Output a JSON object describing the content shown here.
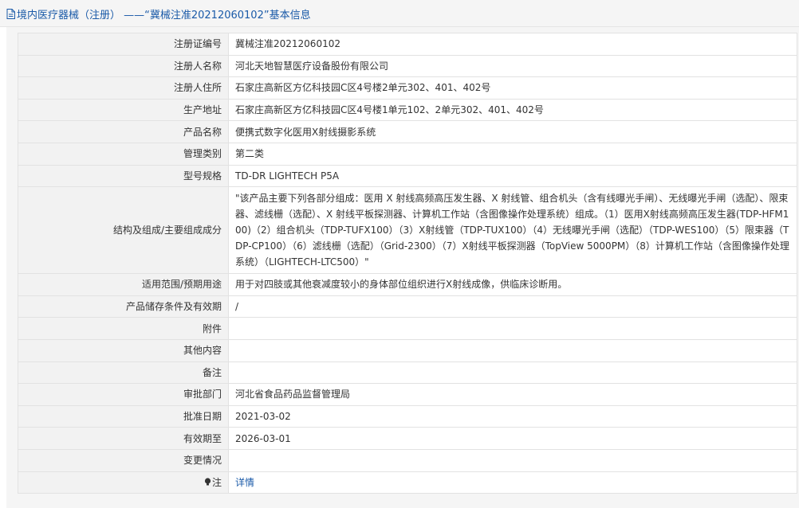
{
  "header": {
    "title": "境内医疗器械（注册） ——“冀械注准20212060102”基本信息"
  },
  "rows": [
    {
      "label": "注册证编号",
      "value": "冀械注准20212060102"
    },
    {
      "label": "注册人名称",
      "value": "河北天地智慧医疗设备股份有限公司"
    },
    {
      "label": "注册人住所",
      "value": "石家庄高新区方亿科技园C区4号楼2单元302、401、402号"
    },
    {
      "label": "生产地址",
      "value": "石家庄高新区方亿科技园C区4号楼1单元102、2单元302、401、402号"
    },
    {
      "label": "产品名称",
      "value": "便携式数字化医用X射线摄影系统"
    },
    {
      "label": "管理类别",
      "value": "第二类"
    },
    {
      "label": "型号规格",
      "value": "TD-DR LIGHTECH P5A"
    },
    {
      "label": "结构及组成/主要组成成分",
      "value": "\"该产品主要下列各部分组成：医用 X 射线高频高压发生器、X 射线管、组合机头（含有线曝光手闸）、无线曝光手闸（选配）、限束器、滤线栅（选配）、X 射线平板探测器、计算机工作站（含图像操作处理系统）组成。（1）医用X射线高频高压发生器(TDP-HFM100)（2）组合机头（TDP-TUFX100）（3）X射线管（TDP-TUX100）（4）无线曝光手闸（选配）（TDP-WES100）（5）限束器（TDP-CP100）（6）滤线栅（选配）（Grid-2300）（7）X射线平板探测器（TopView 5000PM）（8）计算机工作站（含图像操作处理系统）（LIGHTECH-LTC500）\""
    },
    {
      "label": "适用范围/预期用途",
      "value": "用于对四肢或其他衰减度较小的身体部位组织进行X射线成像，供临床诊断用。"
    },
    {
      "label": "产品储存条件及有效期",
      "value": "/"
    },
    {
      "label": "附件",
      "value": ""
    },
    {
      "label": "其他内容",
      "value": ""
    },
    {
      "label": "备注",
      "value": ""
    },
    {
      "label": "审批部门",
      "value": "河北省食品药品监督管理局"
    },
    {
      "label": "批准日期",
      "value": "2021-03-02"
    },
    {
      "label": "有效期至",
      "value": "2026-03-01"
    },
    {
      "label": "变更情况",
      "value": ""
    }
  ],
  "note": {
    "label": "注",
    "link": "详情",
    "icon": "lightbulb-icon"
  },
  "colors": {
    "accent": "#1a5aa8",
    "label_bg": "#f2f2f2",
    "border": "#e2e2e2",
    "page_bg": "#f5f5f5"
  }
}
